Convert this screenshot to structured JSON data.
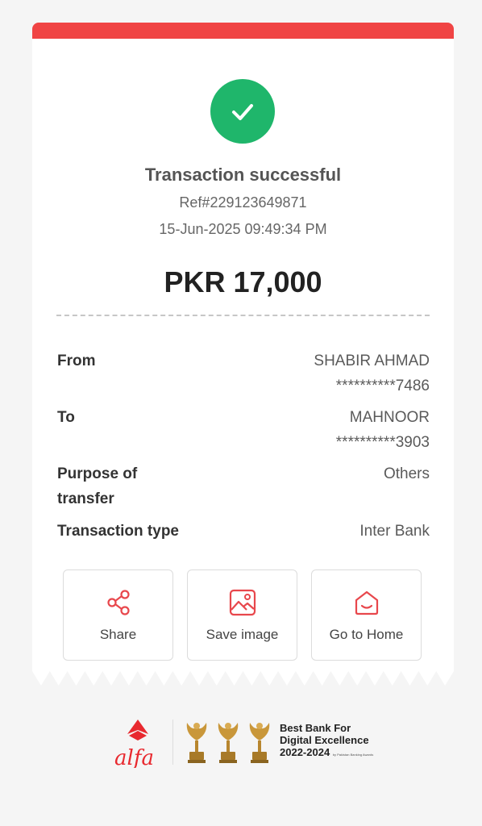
{
  "status": {
    "title": "Transaction successful",
    "ref": "Ref#229123649871",
    "datetime": "15-Jun-2025 09:49:34 PM",
    "icon": "check-icon",
    "color": "#1fb66b"
  },
  "amount": "PKR 17,000",
  "details": {
    "from_label": "From",
    "from_name": "SHABIR AHMAD",
    "from_account": "**********7486",
    "to_label": "To",
    "to_name": "MAHNOOR",
    "to_account": "**********3903",
    "purpose_label_line1": "Purpose of",
    "purpose_label_line2": "transfer",
    "purpose_value": "Others",
    "type_label": "Transaction type",
    "type_value": "Inter Bank"
  },
  "actions": {
    "share": "Share",
    "save_image": "Save image",
    "home": "Go to Home"
  },
  "footer": {
    "brand": "alfa",
    "award_line1": "Best Bank For",
    "award_line2": "Digital Excellence",
    "award_line3": "2022-2024",
    "award_note": "by Pakistan Banking Awards"
  },
  "colors": {
    "accent": "#f04444",
    "success": "#1fb66b",
    "gold": "#c9973a"
  }
}
